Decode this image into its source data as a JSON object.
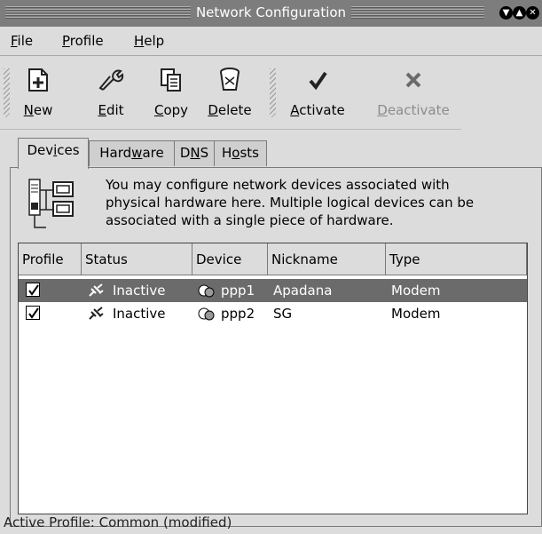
{
  "window": {
    "title": "Network Configuration"
  },
  "menu": [
    {
      "pre": "",
      "u": "F",
      "post": "ile"
    },
    {
      "pre": "",
      "u": "P",
      "post": "rofile"
    },
    {
      "pre": "",
      "u": "H",
      "post": "elp"
    }
  ],
  "toolbar": [
    {
      "pre": "",
      "u": "N",
      "post": "ew",
      "icon": "new-icon",
      "enabled": true
    },
    {
      "pre": "",
      "u": "E",
      "post": "dit",
      "icon": "edit-icon",
      "enabled": true
    },
    {
      "pre": "",
      "u": "C",
      "post": "opy",
      "icon": "copy-icon",
      "enabled": true
    },
    {
      "pre": "",
      "u": "D",
      "post": "elete",
      "icon": "delete-icon",
      "enabled": true
    },
    {
      "pre": "",
      "u": "A",
      "post": "ctivate",
      "icon": "activate-icon",
      "enabled": true
    },
    {
      "pre": "",
      "u": "D",
      "post": "eactivate",
      "icon": "deactivate-icon",
      "enabled": false
    }
  ],
  "tabs": [
    {
      "pre": "Dev",
      "u": "i",
      "post": "ces",
      "active": true
    },
    {
      "pre": "Hard",
      "u": "w",
      "post": "are",
      "active": false
    },
    {
      "pre": "D",
      "u": "N",
      "post": "S",
      "active": false
    },
    {
      "pre": "H",
      "u": "o",
      "post": "sts",
      "active": false
    }
  ],
  "info": {
    "line1": "You may configure network devices associated with",
    "line2": "physical hardware here.  Multiple logical devices can be",
    "line3": "associated with a single piece of hardware."
  },
  "columns": [
    "Profile",
    "Status",
    "Device",
    "Nickname",
    "Type"
  ],
  "rows": [
    {
      "profile_checked": true,
      "status": "Inactive",
      "device": "ppp1",
      "nickname": "Apadana",
      "type": "Modem",
      "selected": true
    },
    {
      "profile_checked": true,
      "status": "Inactive",
      "device": "ppp2",
      "nickname": "SG",
      "type": "Modem",
      "selected": false
    }
  ],
  "statusbar": {
    "text": "Active Profile: Common (modified)"
  }
}
